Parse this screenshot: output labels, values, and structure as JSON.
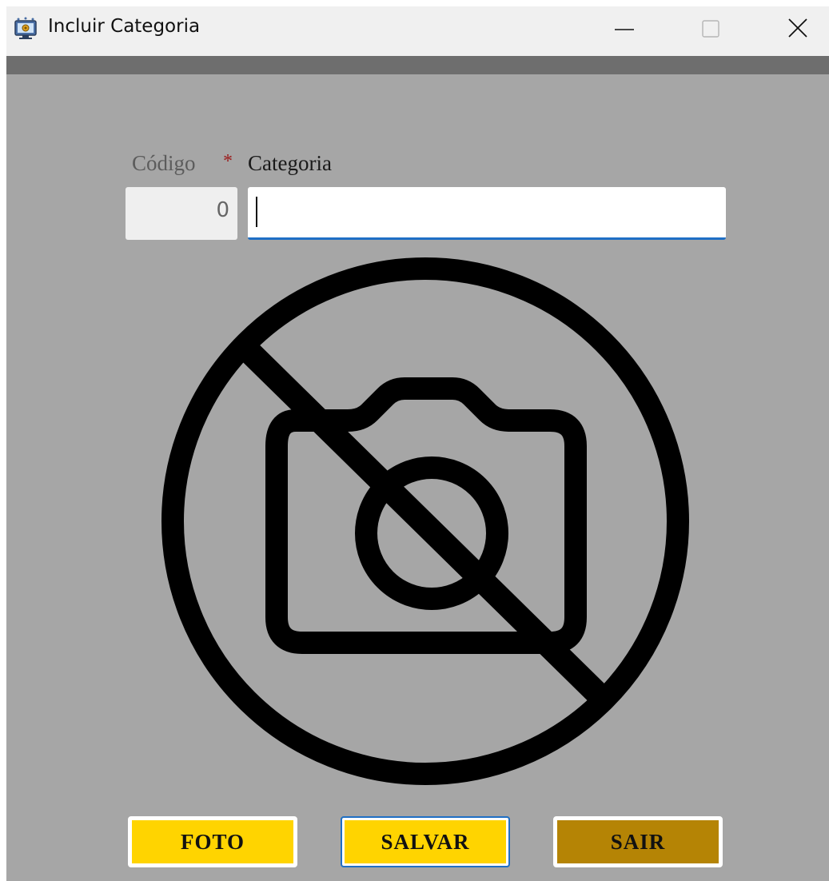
{
  "window": {
    "title": "Incluir Categoria",
    "icons": {
      "app": "monitor-gear-icon",
      "minimize": "minimize-icon",
      "maximize": "maximize-icon",
      "close": "close-icon"
    }
  },
  "form": {
    "codigo_label": "Código",
    "required_marker": "*",
    "categoria_label": "Categoria",
    "codigo_value": "0",
    "categoria_value": ""
  },
  "photo": {
    "icon": "no-camera-icon"
  },
  "buttons": {
    "foto": "FOTO",
    "salvar": "SALVAR",
    "sair": "SAIR"
  },
  "colors": {
    "background": "#a6a6a6",
    "toolbar_strip": "#6e6e6e",
    "button_yellow": "#ffd400",
    "button_dark_gold": "#b58405",
    "focus_blue": "#1f6fc5",
    "required_red": "#9b1c1c"
  }
}
